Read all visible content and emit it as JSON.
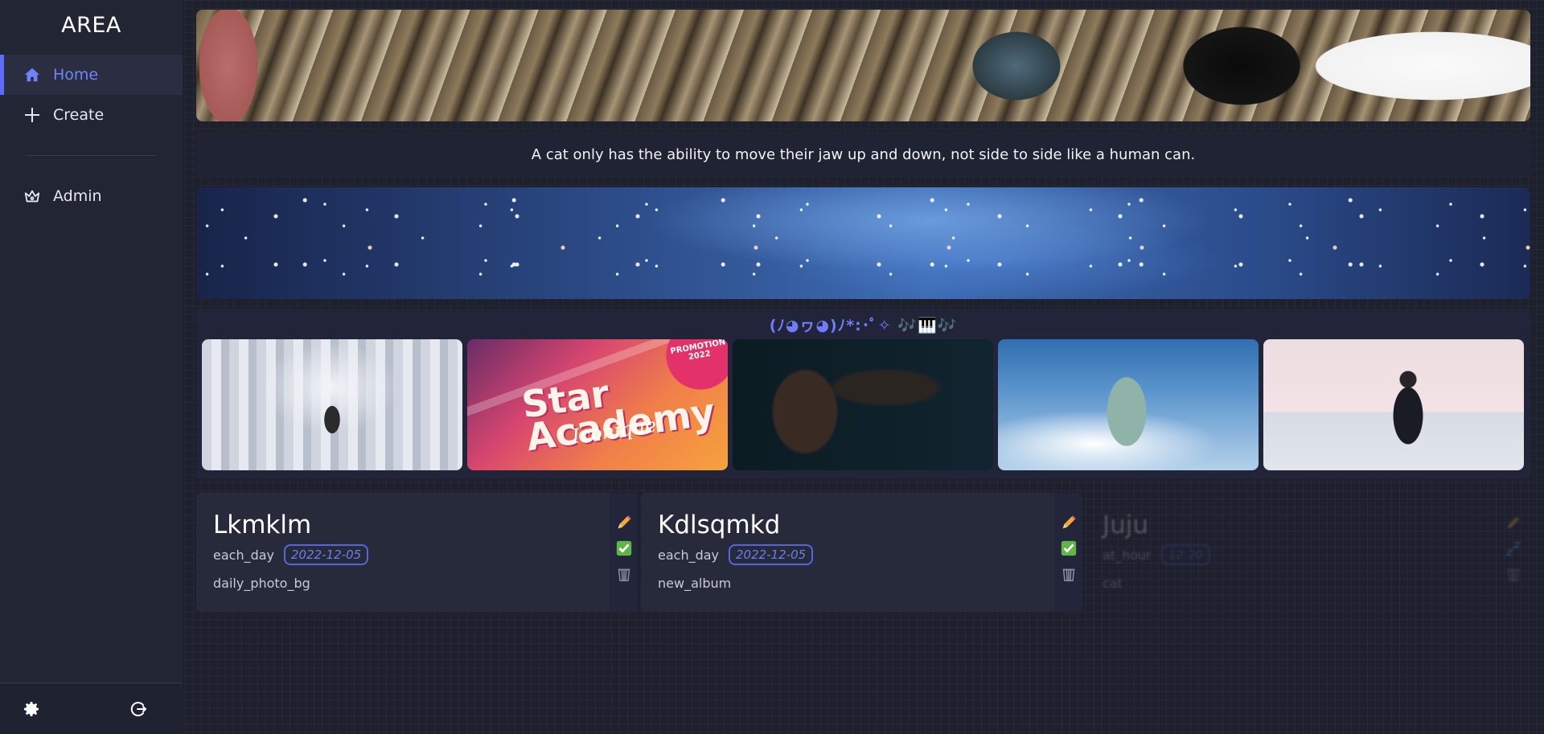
{
  "sidebar": {
    "brand": "AREA",
    "items": [
      {
        "label": "Home",
        "icon": "home-icon",
        "active": true
      },
      {
        "label": "Create",
        "icon": "plus-icon",
        "active": false
      },
      {
        "label": "Admin",
        "icon": "crown-icon",
        "active": false
      }
    ],
    "footer": {
      "settings_icon": "gear-icon",
      "logout_icon": "logout-icon"
    }
  },
  "main": {
    "cat_fact": "A cat only has the ability to move their jaw up and down, not side to side like a human can.",
    "music_title": "(ﾉ◕ヮ◕)ﾉ*:･ﾟ✧ 🎶🎹🎶",
    "albums": [
      {
        "cover": "white-statues-album-cover"
      },
      {
        "cover": "star-academy-album-cover",
        "text": "Star Academy",
        "sub": "Iconique",
        "badge": "PROMOTION 2022"
      },
      {
        "cover": "hands-portrait-album-cover"
      },
      {
        "cover": "woman-on-ladder-album-cover"
      },
      {
        "cover": "man-in-sea-album-cover"
      }
    ],
    "areas": [
      {
        "name": "Lkmklm",
        "trigger": "each_day",
        "date": "2022-12-05",
        "reaction": "daily_photo_bg",
        "enabled": true,
        "status_icon": "check-icon"
      },
      {
        "name": "Kdlsqmkd",
        "trigger": "each_day",
        "date": "2022-12-05",
        "reaction": "new_album",
        "enabled": true,
        "status_icon": "check-icon"
      },
      {
        "name": "Juju",
        "trigger": "at_hour",
        "date": "12:20",
        "reaction": "cat",
        "enabled": false,
        "status_icon": "sleep-icon"
      }
    ]
  },
  "colors": {
    "accent": "#6f83ff",
    "sidebar_bg": "#222533",
    "page_bg": "#1e202d",
    "card_bg": "#272a3b"
  }
}
